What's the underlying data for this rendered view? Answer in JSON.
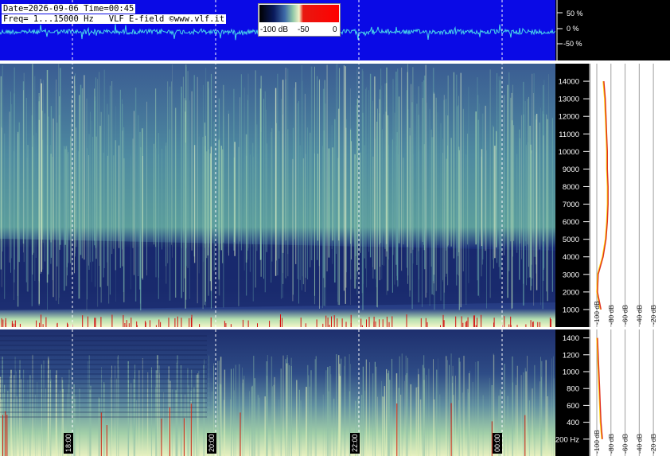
{
  "header": {
    "line1": "Date=2026-09-06 Time=00:45",
    "line2": "Freq= 1...15000 Hz   VLF E-field ©www.vlf.it"
  },
  "colorbar": {
    "labels": [
      "-100 dB",
      "-50",
      "0"
    ],
    "colors": [
      "#000000",
      "#0a1a5c",
      "#3e6aa8",
      "#8fc7a8",
      "#f2f2c8",
      "#e81810",
      "#ff0000"
    ]
  },
  "waveform": {
    "ticks": [
      "50 %",
      "0 %",
      "-50 %"
    ],
    "background": "#0a0ae6",
    "trace_color": "#49d6e8"
  },
  "time_labels": [
    "18:00",
    "20:00",
    "22:00",
    "00:00"
  ],
  "chart_data": [
    {
      "type": "heatmap",
      "name": "upper-spectrogram",
      "ylabel": "",
      "y_ticks": [
        1000,
        2000,
        3000,
        4000,
        5000,
        6000,
        7000,
        8000,
        9000,
        10000,
        11000,
        12000,
        13000,
        14000
      ],
      "ylim": [
        0,
        15000
      ],
      "x_ticks": [
        "18:00",
        "20:00",
        "22:00",
        "00:00"
      ]
    },
    {
      "type": "heatmap",
      "name": "lower-spectrogram",
      "y_ticks": [
        "200 Hz",
        "400",
        "600",
        "800",
        "1000",
        "1200",
        "1400"
      ],
      "ylim": [
        0,
        1500
      ],
      "x_ticks": [
        "18:00",
        "20:00",
        "22:00",
        "00:00"
      ]
    },
    {
      "type": "line",
      "name": "upper-spectrum-profile",
      "x_tick_labels": [
        "-100 dB",
        "-80 dB",
        "-60 dB",
        "-40 dB",
        "-20 dB"
      ],
      "xlim": [
        -100,
        -10
      ],
      "series": [
        {
          "color": "#ffd400",
          "y": [
            1000,
            2000,
            3000,
            4000,
            5000,
            6000,
            7000,
            8000,
            9000,
            10000,
            11000,
            12000,
            13000,
            14000
          ],
          "x": [
            -95,
            -100,
            -99,
            -92,
            -88,
            -86,
            -85,
            -85,
            -86,
            -86,
            -87,
            -88,
            -89,
            -91
          ]
        },
        {
          "color": "#e03020",
          "y": [
            1000,
            2000,
            3000,
            4000,
            5000,
            6000,
            7000,
            8000,
            9000,
            10000,
            11000,
            12000,
            13000,
            14000
          ],
          "x": [
            -94,
            -99,
            -98,
            -91,
            -87,
            -85,
            -84,
            -84,
            -85,
            -85,
            -86,
            -87,
            -88,
            -90
          ]
        }
      ]
    },
    {
      "type": "line",
      "name": "lower-spectrum-profile",
      "x_tick_labels": [
        "-100 dB",
        "-80 dB",
        "-60 dB",
        "-40 dB",
        "-20 dB"
      ],
      "xlim": [
        -100,
        -10
      ],
      "series": [
        {
          "color": "#ffd400",
          "y": [
            200,
            400,
            600,
            800,
            1000,
            1200,
            1400
          ],
          "x": [
            -93,
            -95,
            -96,
            -97,
            -98,
            -99,
            -100
          ]
        },
        {
          "color": "#e03020",
          "y": [
            200,
            400,
            600,
            800,
            1000,
            1200,
            1400
          ],
          "x": [
            -92,
            -94,
            -95,
            -96,
            -97,
            -98,
            -99
          ]
        }
      ]
    }
  ]
}
